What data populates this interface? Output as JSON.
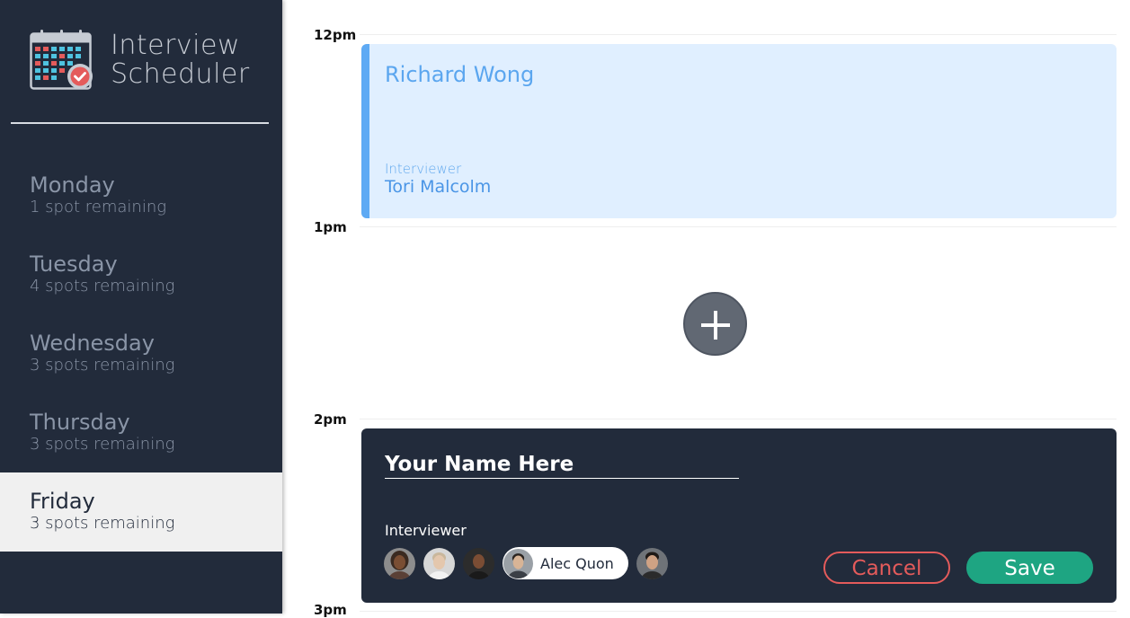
{
  "app": {
    "title_line1": "Interview",
    "title_line2": "Scheduler"
  },
  "days": [
    {
      "name": "Monday",
      "spots": "1 spot remaining",
      "selected": false
    },
    {
      "name": "Tuesday",
      "spots": "4 spots remaining",
      "selected": false
    },
    {
      "name": "Wednesday",
      "spots": "3 spots remaining",
      "selected": false
    },
    {
      "name": "Thursday",
      "spots": "3 spots remaining",
      "selected": false
    },
    {
      "name": "Friday",
      "spots": "3 spots remaining",
      "selected": true
    }
  ],
  "times": [
    "12pm",
    "1pm",
    "2pm",
    "3pm"
  ],
  "appointment": {
    "student": "Richard Wong",
    "interviewer_label": "Interviewer",
    "interviewer": "Tori Malcolm"
  },
  "form": {
    "name_placeholder": "Your Name Here",
    "interviewer_label": "Interviewer",
    "selected_interviewer": "Alec Quon",
    "cancel_label": "Cancel",
    "save_label": "Save"
  },
  "colors": {
    "sidebar": "#222b3b",
    "selected_day": "#f0f0f0",
    "appointment_bg": "#e0efff",
    "appointment_accent": "#5eaaf4",
    "cancel": "#e45b5b",
    "save": "#1ea582"
  }
}
